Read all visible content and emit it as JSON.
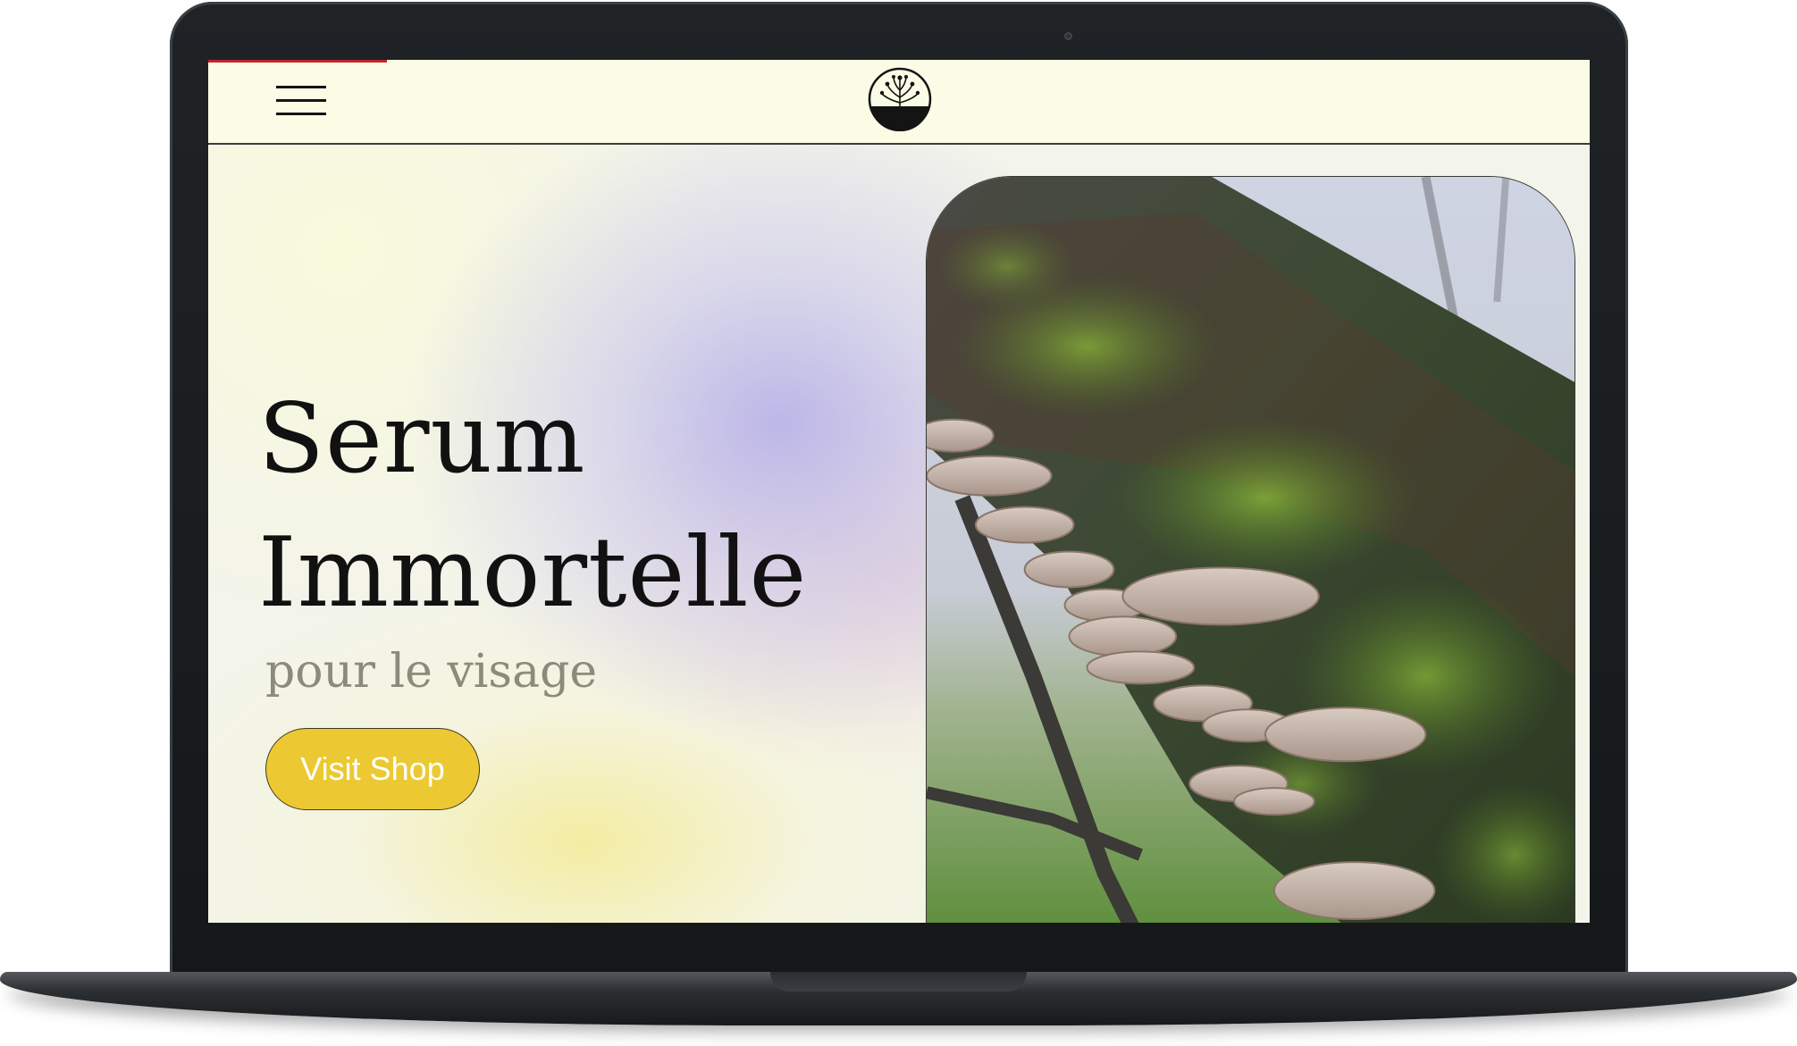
{
  "header": {
    "menu_icon": "hamburger-menu-icon",
    "logo_icon": "botanical-seedling-logo"
  },
  "hero": {
    "title_line1": "Serum",
    "title_line2": "Immortelle",
    "subtitle": "pour le visage",
    "cta_label": "Visit Shop",
    "image_description_icon": "mushroom-on-mossy-branch-photo"
  },
  "colors": {
    "cta_background": "#ecc932",
    "page_background": "#fafbe8",
    "accent_red": "#c0262b",
    "text_primary": "#111111",
    "text_subtitle": "#8c8a7b"
  }
}
